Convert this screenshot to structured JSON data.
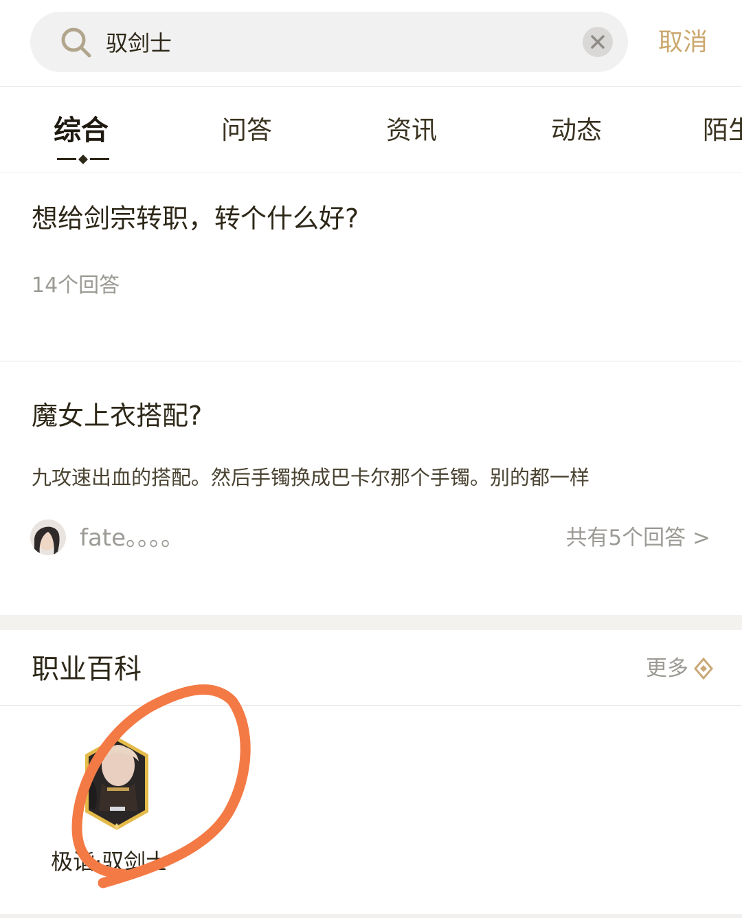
{
  "search": {
    "query": "驭剑士",
    "cancel_label": "取消"
  },
  "tabs": [
    {
      "label": "综合",
      "active": true
    },
    {
      "label": "问答",
      "active": false
    },
    {
      "label": "资讯",
      "active": false
    },
    {
      "label": "动态",
      "active": false
    },
    {
      "label": "陌生",
      "active": false
    }
  ],
  "results": [
    {
      "title": "想给剑宗转职，转个什么好?",
      "answer_count": "14个回答"
    },
    {
      "title": "魔女上衣搭配?",
      "snippet": "九攻速出血的搭配。然后手镯换成巴卡尔那个手镯。别的都一样",
      "author": "fate。。。。",
      "answers_link": "共有5个回答 >"
    }
  ],
  "encyclopedia": {
    "title": "职业百科",
    "more_label": "更多",
    "classes": [
      {
        "name": "极诣·驭剑士"
      }
    ]
  },
  "icons": {
    "search": "search-icon",
    "clear": "close-icon",
    "more": "diamond-arrow-icon"
  },
  "colors": {
    "accent_gold": "#cba86e",
    "text_dark": "#2d2718",
    "text_muted": "#9c9a95",
    "annotation": "#f47a45"
  }
}
